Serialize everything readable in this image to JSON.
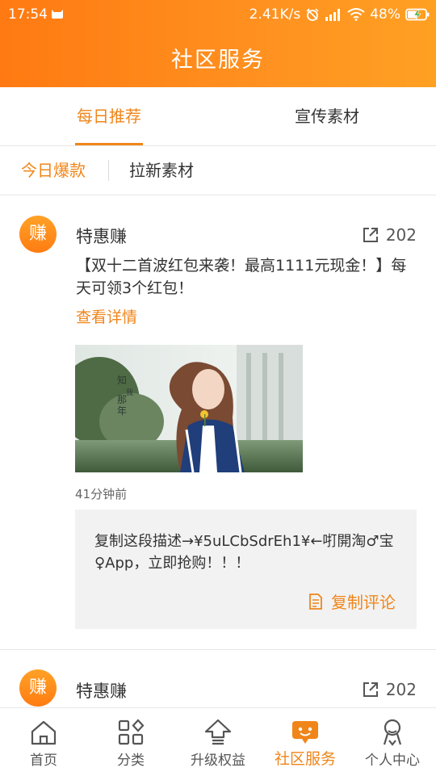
{
  "status_bar": {
    "time": "17:54",
    "network_speed": "2.41K/s",
    "battery": "48%"
  },
  "header": {
    "title": "社区服务"
  },
  "tabs": [
    {
      "label": "每日推荐",
      "active": true
    },
    {
      "label": "宣传素材",
      "active": false
    }
  ],
  "subtabs": [
    {
      "label": "今日爆款",
      "active": true
    },
    {
      "label": "拉新素材",
      "active": false
    }
  ],
  "posts": [
    {
      "avatar_text": "赚",
      "author": "特惠赚",
      "share_count": "202",
      "body": "【双十二首波红包来袭！最高1111元现金！】每天可领3个红包！",
      "details_label": "查看详情",
      "image_text": [
        "知",
        "我",
        "那",
        "年"
      ],
      "time": "41分钟前",
      "comment": "复制这段描述→¥5uLCbSdrEh1¥←咑開淘♂宝♀App，立即抢购！！！",
      "copy_label": "复制评论"
    },
    {
      "avatar_text": "赚",
      "author": "特惠赚",
      "share_count": "202"
    }
  ],
  "bottom_nav": [
    {
      "label": "首页",
      "icon": "home-icon",
      "active": false
    },
    {
      "label": "分类",
      "icon": "grid-icon",
      "active": false
    },
    {
      "label": "升级权益",
      "icon": "upgrade-icon",
      "active": false
    },
    {
      "label": "社区服务",
      "icon": "chat-icon",
      "active": true
    },
    {
      "label": "个人中心",
      "icon": "person-icon",
      "active": false
    }
  ],
  "colors": {
    "accent": "#f08519",
    "header_start": "#ff7a12",
    "header_end": "#ffa022"
  }
}
